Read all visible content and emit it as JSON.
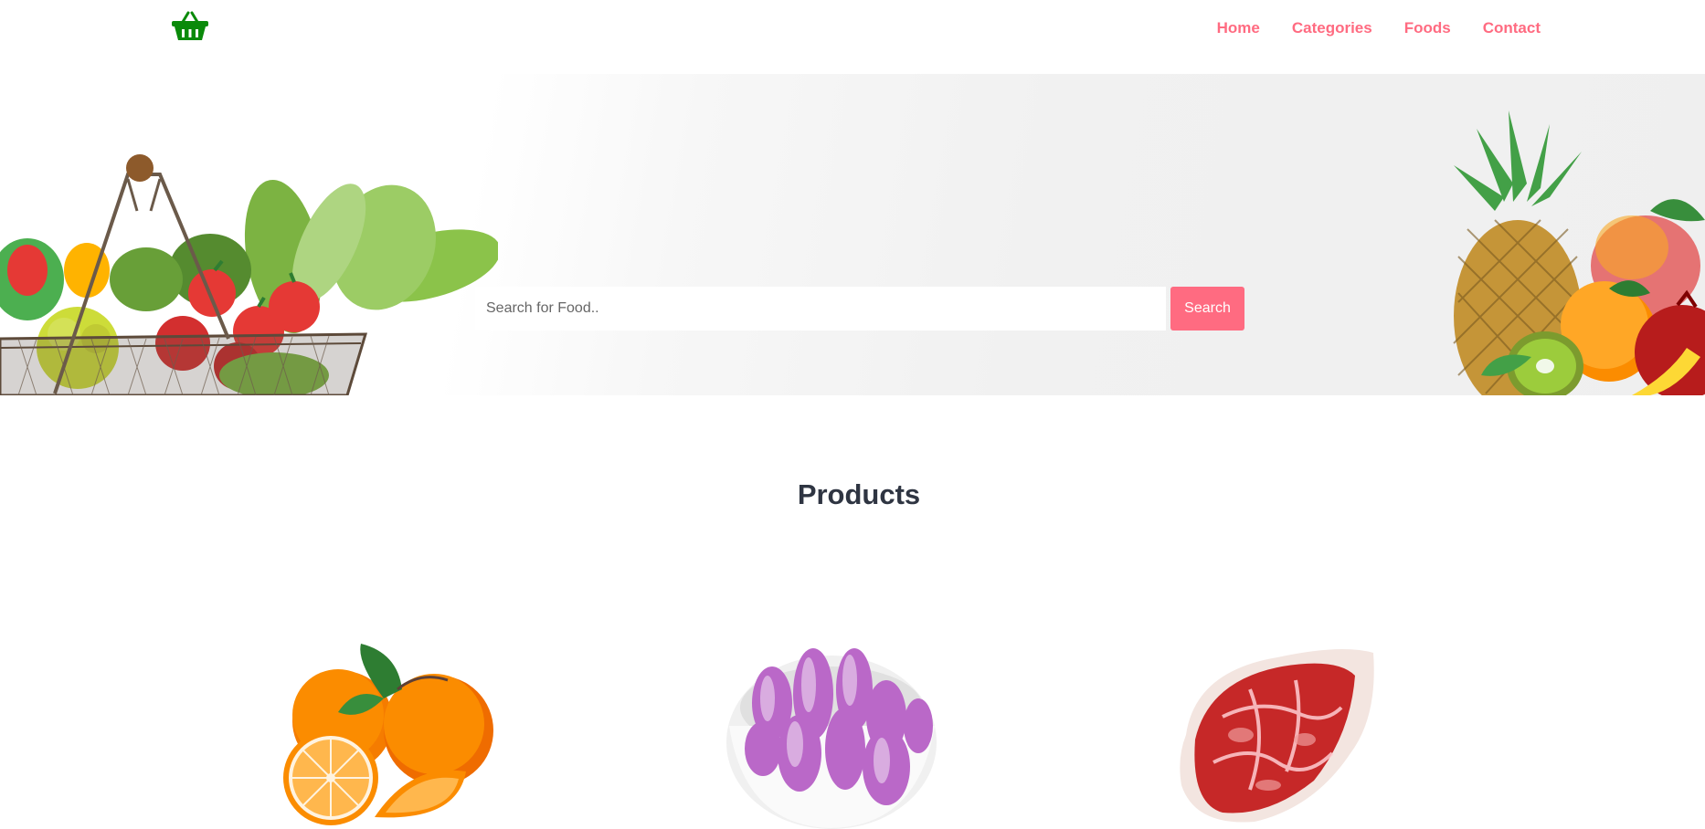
{
  "header": {
    "logo_icon": "shopping-basket-icon",
    "logo_color": "#0a8a0a",
    "nav": [
      {
        "label": "Home"
      },
      {
        "label": "Categories"
      },
      {
        "label": "Foods"
      },
      {
        "label": "Contact"
      }
    ],
    "nav_color": "#ff6b81"
  },
  "hero": {
    "search": {
      "placeholder": "Search for Food..",
      "value": "",
      "button_label": "Search"
    },
    "accent_color": "#ff6b81"
  },
  "products": {
    "title": "Products",
    "items": [
      {
        "image": "oranges-image"
      },
      {
        "image": "shallots-bowl-image"
      },
      {
        "image": "raw-steak-image"
      }
    ]
  }
}
